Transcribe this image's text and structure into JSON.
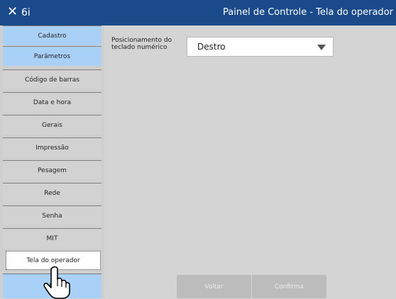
{
  "titlebar": {
    "close_glyph": "✕",
    "app_name": "6i",
    "title": "Painel de Controle - Tela do operador"
  },
  "sidebar": {
    "items": [
      {
        "label": "Cadastro",
        "style": "blue"
      },
      {
        "label": "Parâmetros",
        "style": "blue"
      },
      {
        "label": "Código de barras",
        "style": "gray"
      },
      {
        "label": "Data e hora",
        "style": "gray"
      },
      {
        "label": "Gerais",
        "style": "gray"
      },
      {
        "label": "Impressão",
        "style": "gray"
      },
      {
        "label": "Pesagem",
        "style": "gray"
      },
      {
        "label": "Rede",
        "style": "gray"
      },
      {
        "label": "Senha",
        "style": "gray"
      },
      {
        "label": "MIT",
        "style": "gray"
      },
      {
        "label": "Tela do operador",
        "style": "selected"
      },
      {
        "label": "In",
        "style": "blue"
      }
    ]
  },
  "content": {
    "field_label": "Posicionamento do teclado numérico",
    "dropdown_value": "Destro",
    "back_label": "Voltar",
    "confirm_label": "Confirma"
  },
  "colors": {
    "titlebar_bg": "#1a4a8a",
    "menu_blue": "#a9d1f7",
    "menu_gray": "#d2d2d2"
  },
  "icons": {
    "close": "close-icon",
    "dropdown": "chevron-down-icon",
    "cursor": "hand-pointer-icon"
  }
}
